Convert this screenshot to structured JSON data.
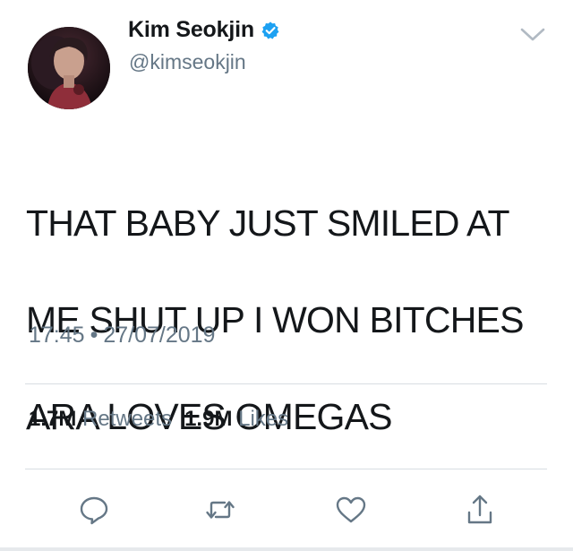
{
  "user": {
    "display_name": "Kim Seokjin",
    "handle": "@kimseokjin",
    "verified": true
  },
  "tweet": {
    "lines": [
      "THAT BABY JUST SMILED AT",
      "ME SHUT UP I WON BITCHES",
      "ARA LOVES OMEGAS"
    ],
    "time": "17:45",
    "separator": "•",
    "date": "27/07/2019"
  },
  "stats": {
    "retweets_count": "1.7M",
    "retweets_label": "Retweets",
    "likes_count": "1.9M",
    "likes_label": "Likes"
  },
  "icons": {
    "verified": "verified-badge-icon",
    "menu": "chevron-down-icon",
    "reply": "reply-icon",
    "retweet": "retweet-icon",
    "like": "heart-icon",
    "share": "share-icon"
  },
  "colors": {
    "text": "#14171a",
    "secondary": "#657786",
    "verified_blue": "#1da1f2",
    "divider": "#d8dde2"
  }
}
